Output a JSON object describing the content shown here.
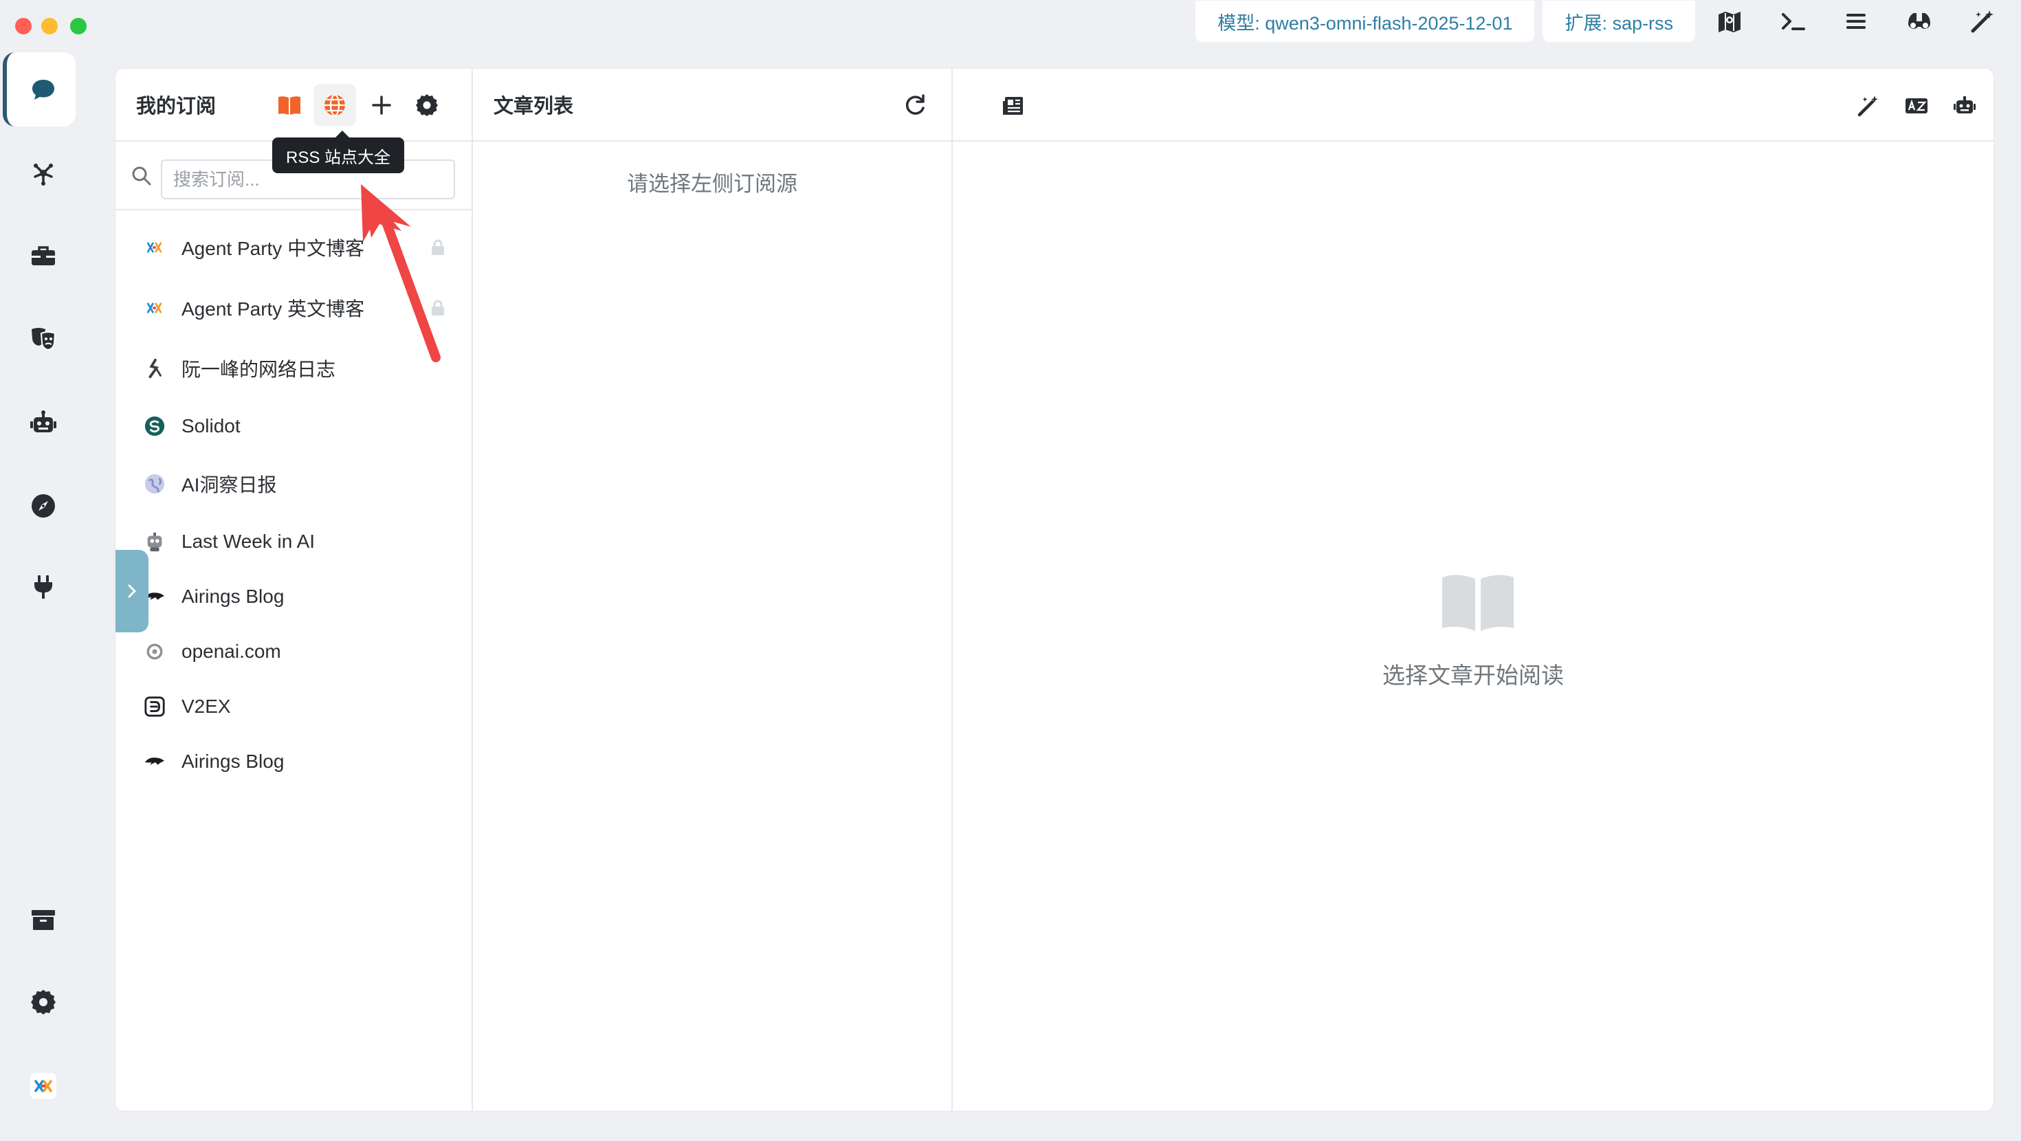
{
  "window": {
    "traffic_lights": [
      "close",
      "minimize",
      "zoom"
    ]
  },
  "topbar": {
    "model_pill": "模型: qwen3-omni-flash-2025-12-01",
    "extension_pill": "扩展: sap-rss",
    "icons": [
      "map-icon",
      "terminal-icon",
      "menu-icon",
      "binoculars-icon",
      "magic-wand-icon"
    ]
  },
  "rail": {
    "items": [
      {
        "icon": "chat-icon",
        "active": true
      },
      {
        "icon": "network-icon"
      },
      {
        "icon": "toolbox-icon"
      },
      {
        "icon": "masks-icon"
      },
      {
        "icon": "robot-icon"
      },
      {
        "icon": "compass-icon"
      },
      {
        "icon": "plug-icon"
      },
      {
        "icon": "archive-icon"
      },
      {
        "icon": "settings-icon"
      },
      {
        "icon": "app-logo-icon"
      }
    ]
  },
  "subscriptions": {
    "title": "我的订阅",
    "search_placeholder": "搜索订阅...",
    "tooltip": "RSS 站点大全",
    "feeds": [
      {
        "label": "Agent Party 中文博客",
        "icon": "agent-party-icon",
        "locked": true
      },
      {
        "label": "Agent Party 英文博客",
        "icon": "agent-party-icon",
        "locked": true
      },
      {
        "label": "阮一峰的网络日志",
        "icon": "ruanyifeng-icon",
        "locked": false
      },
      {
        "label": "Solidot",
        "icon": "solidot-icon",
        "locked": false
      },
      {
        "label": "AI洞察日报",
        "icon": "globe-icon",
        "locked": false
      },
      {
        "label": "Last Week in AI",
        "icon": "robot-avatar-icon",
        "locked": false
      },
      {
        "label": "Airings Blog",
        "icon": "airings-icon",
        "locked": false
      },
      {
        "label": "openai.com",
        "icon": "openai-icon",
        "locked": false
      },
      {
        "label": "V2EX",
        "icon": "v2ex-icon",
        "locked": false
      },
      {
        "label": "Airings Blog",
        "icon": "airings-icon",
        "locked": false
      }
    ]
  },
  "articles": {
    "title": "文章列表",
    "empty_text": "请选择左侧订阅源"
  },
  "reader": {
    "empty_text": "选择文章开始阅读"
  },
  "colors": {
    "accent": "#2e7ea5",
    "rss_orange": "#f0642a",
    "annotation_arrow": "#ef4545",
    "collapse_tab": "#7fb5c9"
  }
}
